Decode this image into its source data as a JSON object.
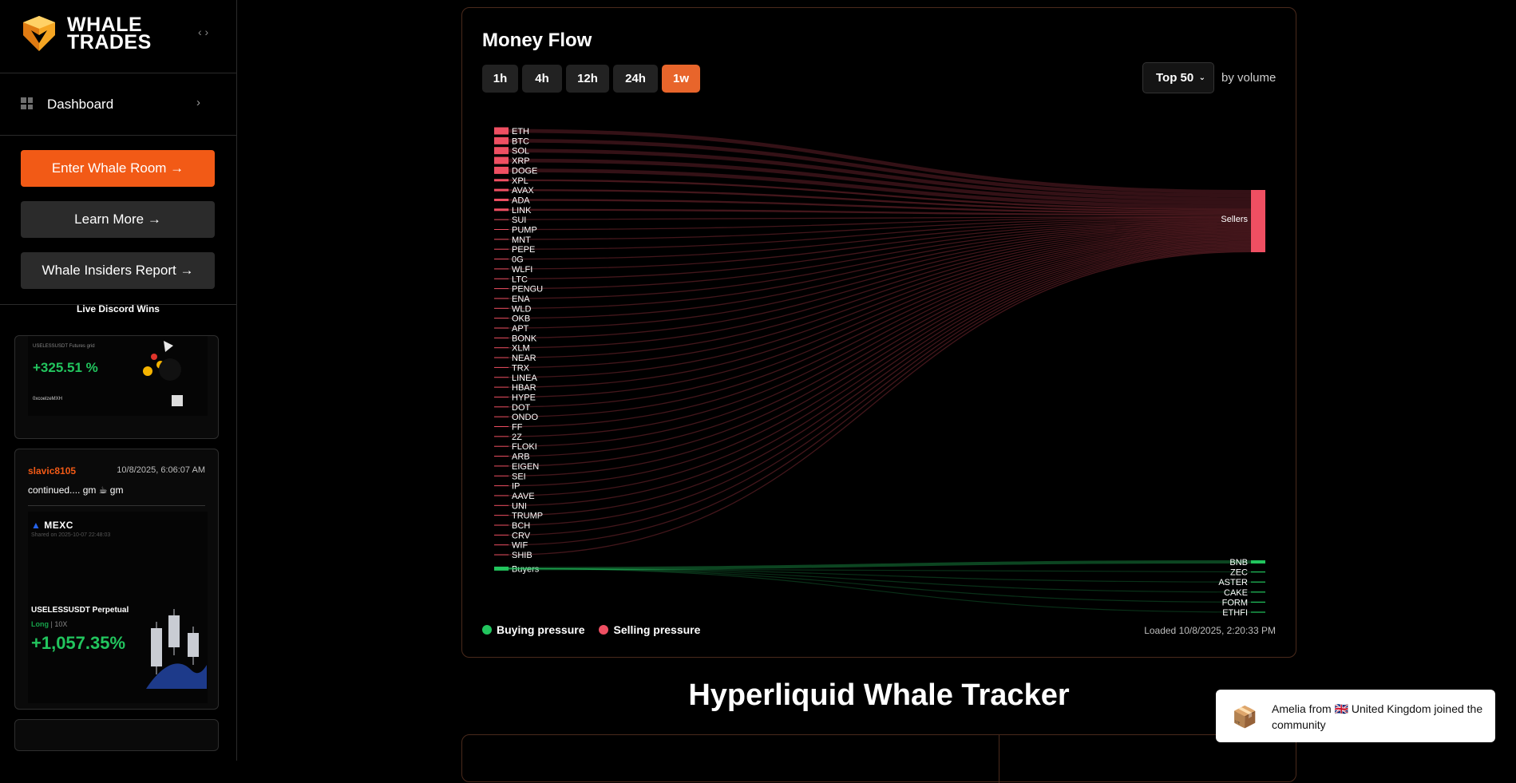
{
  "brand": {
    "line1": "WHALE",
    "line2": "TRADES"
  },
  "sidebar": {
    "collapse_icon": "‹ ›",
    "nav_dashboard": "Dashboard",
    "buttons": {
      "enter": "Enter Whale Room →",
      "learn": "Learn More →",
      "report": "Whale Insiders Report →"
    },
    "live_title": "Live Discord Wins",
    "cards": [
      {
        "pair": "USELESSUSDT Futures grid",
        "pct": "+325.51 %",
        "user": "0xcoelzeMXH"
      },
      {
        "user": "slavic8105",
        "timestamp": "10/8/2025, 6:06:07 AM",
        "message": "continued.... gm ☕ gm",
        "exchange": "MEXC",
        "shared": "Shared on 2025-10-07 22:48:03",
        "pair": "USELESSUSDT Perpetual",
        "side": "Long",
        "leverage": "10X",
        "pct": "+1,057.35%"
      }
    ]
  },
  "money_flow": {
    "title": "Money Flow",
    "tabs": [
      "1h",
      "4h",
      "12h",
      "24h",
      "1w"
    ],
    "active_tab": "1w",
    "top_select": "Top 50",
    "by_volume": "by volume",
    "legend_buy": "Buying pressure",
    "legend_sell": "Selling pressure",
    "loaded": "Loaded 10/8/2025, 2:20:33 PM",
    "colors": {
      "buy": "#22c55e",
      "sell": "#ef4f62",
      "accent": "#e8652b"
    }
  },
  "chart_data": {
    "type": "sankey",
    "sell_sources": [
      "ETH",
      "BTC",
      "SOL",
      "XRP",
      "DOGE",
      "XPL",
      "AVAX",
      "ADA",
      "LINK",
      "SUI",
      "PUMP",
      "MNT",
      "PEPE",
      "0G",
      "WLFI",
      "LTC",
      "PENGU",
      "ENA",
      "WLD",
      "OKB",
      "APT",
      "BONK",
      "XLM",
      "NEAR",
      "TRX",
      "LINEA",
      "HBAR",
      "HYPE",
      "DOT",
      "ONDO",
      "FF",
      "2Z",
      "FLOKI",
      "ARB",
      "EIGEN",
      "SEI",
      "IP",
      "AAVE",
      "UNI",
      "TRUMP",
      "BCH",
      "CRV",
      "WIF",
      "SHIB"
    ],
    "sell_target": "Sellers",
    "buy_source": "Buyers",
    "buy_targets": [
      "BNB",
      "ZEC",
      "ASTER",
      "CAKE",
      "FORM",
      "ETHFI"
    ]
  },
  "tracker_title": "Hyperliquid Whale Tracker",
  "toast": {
    "text": "Amelia from 🇬🇧 United Kingdom joined the community"
  }
}
